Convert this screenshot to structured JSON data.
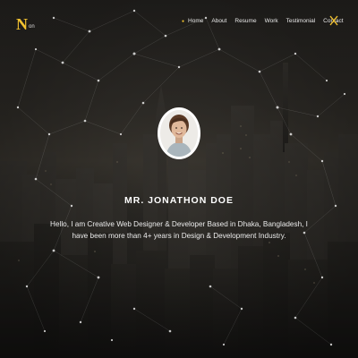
{
  "brand": {
    "logo_letter": "N",
    "logo_rest": "on",
    "accent_color": "#f2c230"
  },
  "nav": {
    "items": [
      "Home",
      "About",
      "Resume",
      "Work",
      "Testimonial",
      "Contact"
    ],
    "close_icon": "close-icon"
  },
  "hero": {
    "name": "MR. JONATHON DOE",
    "bio": "Hello, I am Creative Web Designer & Developer Based in Dhaka, Bangladesh, I have been more than 4+ years in Design & Development Industry.",
    "avatar_icon": "person-avatar"
  }
}
